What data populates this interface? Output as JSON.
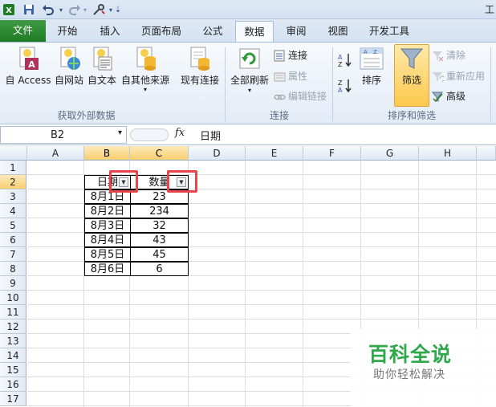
{
  "window": {
    "title_partial": "工"
  },
  "quick_access": {
    "icons": [
      "excel-logo-icon",
      "save-icon",
      "undo-icon",
      "redo-icon",
      "customize-icon"
    ]
  },
  "tabs": [
    {
      "label": "文件",
      "key": "file"
    },
    {
      "label": "开始",
      "key": "home"
    },
    {
      "label": "插入",
      "key": "insert"
    },
    {
      "label": "页面布局",
      "key": "page-layout"
    },
    {
      "label": "公式",
      "key": "formulas"
    },
    {
      "label": "数据",
      "key": "data",
      "active": true
    },
    {
      "label": "审阅",
      "key": "review"
    },
    {
      "label": "视图",
      "key": "view"
    },
    {
      "label": "开发工具",
      "key": "developer"
    }
  ],
  "ribbon": {
    "groups": {
      "external": "获取外部数据",
      "connections": "连接",
      "sort_filter": "排序和筛选"
    },
    "buttons": {
      "from_access": "自 Access",
      "from_web": "自网站",
      "from_text": "自文本",
      "from_other": "自其他来源",
      "existing": "现有连接",
      "refresh_all": "全部刷新",
      "connections": "连接",
      "properties": "属性",
      "edit_links": "编辑链接",
      "sort": "排序",
      "filter": "筛选",
      "clear": "清除",
      "reapply": "重新应用",
      "advanced": "高级"
    },
    "accent": "#fdc84e"
  },
  "formula_bar": {
    "name_box": "B2",
    "fx": "fx",
    "content": "日期"
  },
  "sheet": {
    "columns": [
      "A",
      "B",
      "C",
      "D",
      "E",
      "F",
      "G",
      "H"
    ],
    "rows": [
      "1",
      "2",
      "3",
      "4",
      "5",
      "6",
      "7",
      "8",
      "9",
      "10",
      "11",
      "12",
      "13",
      "14",
      "15",
      "16",
      "17"
    ],
    "headers": {
      "date": "日期",
      "qty": "数量"
    },
    "data": [
      {
        "date": "8月1日",
        "qty": "23"
      },
      {
        "date": "8月2日",
        "qty": "234"
      },
      {
        "date": "8月3日",
        "qty": "32"
      },
      {
        "date": "8月4日",
        "qty": "43"
      },
      {
        "date": "8月5日",
        "qty": "45"
      },
      {
        "date": "8月6日",
        "qty": "6"
      }
    ],
    "highlight_color": "#e8444c"
  },
  "watermark": {
    "title": "百科全说",
    "subtitle": "助你轻松解决",
    "color": "#2fa84a"
  }
}
